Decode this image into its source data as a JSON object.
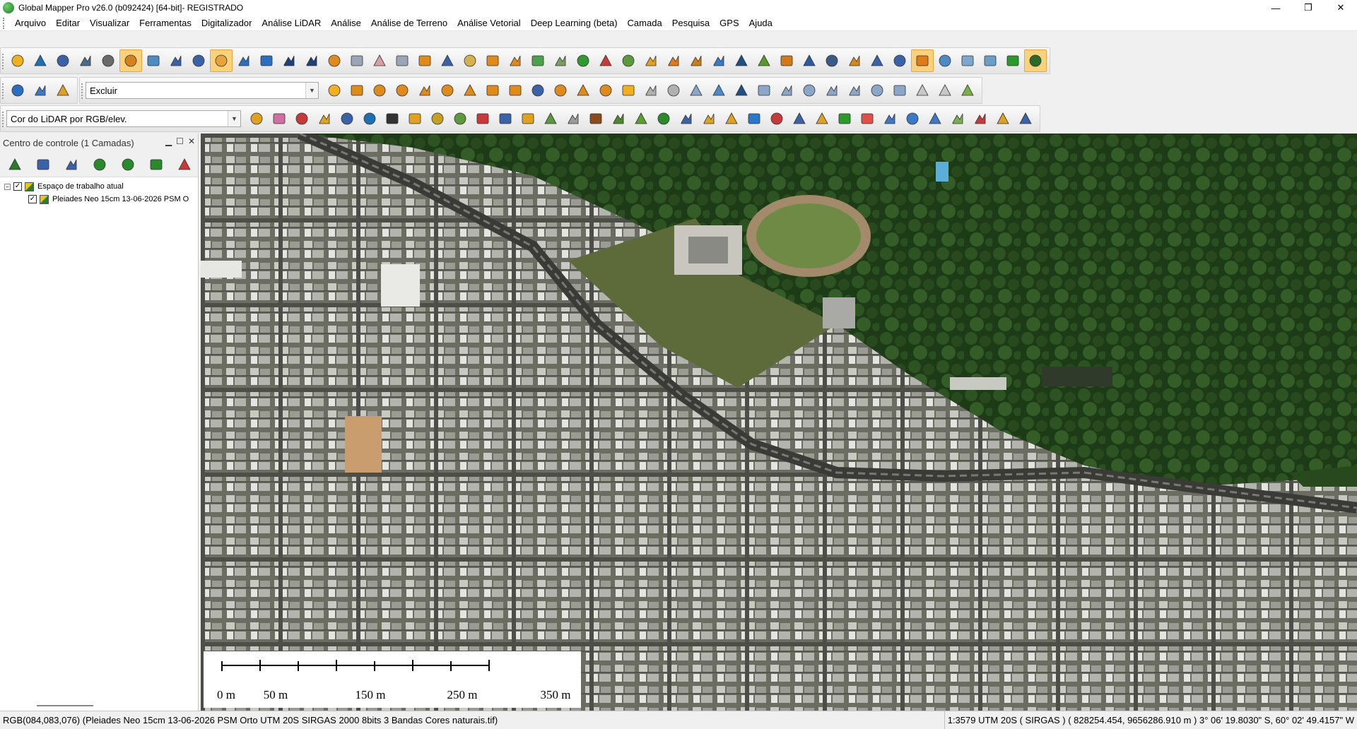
{
  "window": {
    "title": "Global Mapper Pro v26.0 (b092424) [64-bit]- REGISTRADO",
    "minimize": "—",
    "maximize": "❐",
    "close": "✕"
  },
  "menu": [
    "Arquivo",
    "Editar",
    "Visualizar",
    "Ferramentas",
    "Digitalizador",
    "Análise LiDAR",
    "Análise",
    "Análise de Terreno",
    "Análise Vetorial",
    "Deep Learning (beta)",
    "Camada",
    "Pesquisa",
    "GPS",
    "Ajuda"
  ],
  "toolbar": {
    "row1": [
      {
        "icon": "open-folder-icon",
        "color": "#f2b01e"
      },
      {
        "icon": "globe-data-icon",
        "color": "#1f6fb5"
      },
      {
        "icon": "save-icon",
        "color": "#3a62a8"
      },
      {
        "icon": "print-icon",
        "color": "#4a6a8a"
      },
      {
        "icon": "wrench-icon",
        "color": "#6a6a6a"
      },
      {
        "icon": "control-center-icon",
        "color": "#d4821b",
        "active": true
      },
      {
        "icon": "overview-map-icon",
        "color": "#4c8bc4"
      },
      {
        "icon": "find-icon",
        "color": "#3a62a8"
      },
      {
        "icon": "zoom-box-icon",
        "color": "#3a62a8"
      },
      {
        "icon": "pan-hand-icon",
        "color": "#e8a33a",
        "active": true
      },
      {
        "icon": "zoom-in-icon",
        "color": "#2a6fc1"
      },
      {
        "icon": "zoom-out-icon",
        "color": "#2a6fc1"
      },
      {
        "icon": "back-arrow-icon",
        "color": "#1f3f7a"
      },
      {
        "icon": "home-icon",
        "color": "#1f3f7a"
      },
      {
        "icon": "pencil-icon",
        "color": "#e08a1a"
      },
      {
        "icon": "select-box-icon",
        "color": "#9aa6b8"
      },
      {
        "icon": "delete-x-icon",
        "color": "#d8a0a0"
      },
      {
        "icon": "area-select-icon",
        "color": "#9aa6b8"
      },
      {
        "icon": "measure-icon",
        "color": "#e08a1a"
      },
      {
        "icon": "info-icon",
        "color": "#3a62a8"
      },
      {
        "icon": "path-profile-icon",
        "color": "#d6b04a"
      },
      {
        "icon": "lidar-profile-icon",
        "color": "#e08a1a"
      },
      {
        "icon": "terrain-icon",
        "color": "#e08a1a"
      },
      {
        "icon": "contour-icon",
        "color": "#4aa24a"
      },
      {
        "icon": "elevation-shade-icon",
        "color": "#7aa060"
      },
      {
        "icon": "terrain-green-icon",
        "color": "#2f9a2f"
      },
      {
        "icon": "cut-fill-icon",
        "color": "#c93a3a"
      },
      {
        "icon": "watershed-icon",
        "color": "#5a9a3a"
      },
      {
        "icon": "tower-icon",
        "color": "#e0a020"
      },
      {
        "icon": "layers-orange-icon",
        "color": "#e07a1a"
      },
      {
        "icon": "profile-lines-icon",
        "color": "#c8801a"
      },
      {
        "icon": "raster-calc-icon",
        "color": "#3a78c8"
      },
      {
        "icon": "crossing-icon",
        "color": "#1f4f8a"
      },
      {
        "icon": "pen-line-icon",
        "color": "#5a9a2a"
      },
      {
        "icon": "edit-pen-icon",
        "color": "#d07a1a"
      },
      {
        "icon": "house-pin-icon",
        "color": "#2a5aa0"
      },
      {
        "icon": "panels-icon",
        "color": "#3a5a8a"
      },
      {
        "icon": "script-icon",
        "color": "#d08a1a"
      },
      {
        "icon": "split-view-icon",
        "color": "#3a62a8"
      },
      {
        "icon": "3d-view-icon",
        "color": "#3a62a8"
      },
      {
        "icon": "digitize-active-icon",
        "color": "#e07a1a",
        "active": true
      },
      {
        "icon": "mountains-blue-icon",
        "color": "#4a8ac8"
      },
      {
        "icon": "mountain-flag-icon",
        "color": "#7aa8d0"
      },
      {
        "icon": "vegetation-icon",
        "color": "#6aa0c8"
      },
      {
        "icon": "peaks-green-icon",
        "color": "#2a9a2a"
      },
      {
        "icon": "mountains-yellow-icon",
        "color": "#2a6a2a",
        "active": true
      }
    ],
    "row2_left": [
      {
        "icon": "projection-globe-icon",
        "color": "#2a6fc1"
      },
      {
        "icon": "settings-gear-icon",
        "color": "#3a78c8"
      },
      {
        "icon": "night-mode-icon",
        "color": "#e0a020"
      }
    ],
    "style_combo": {
      "value": "Excluir"
    },
    "row2_right": [
      {
        "icon": "favorite-star-icon",
        "color": "#f2b01e"
      },
      {
        "icon": "digitize-line-icon",
        "color": "#e08a1a"
      },
      {
        "icon": "digitize-path-icon",
        "color": "#e08a1a"
      },
      {
        "icon": "digitize-curve-icon",
        "color": "#e08a1a"
      },
      {
        "icon": "edit-vertex-icon",
        "color": "#e08a1a"
      },
      {
        "icon": "smooth-line-icon",
        "color": "#e08a1a"
      },
      {
        "icon": "join-lines-icon",
        "color": "#e08a1a"
      },
      {
        "icon": "measure-angle-icon",
        "color": "#e08a1a"
      },
      {
        "icon": "range-ring-icon",
        "color": "#e08a1a"
      },
      {
        "icon": "grid-create-icon",
        "color": "#3a62a8"
      },
      {
        "icon": "buffer-line-icon",
        "color": "#e08a1a"
      },
      {
        "icon": "offset-line-icon",
        "color": "#e08a1a"
      },
      {
        "icon": "line-tool-icon",
        "color": "#e08a1a"
      },
      {
        "icon": "shape-merge-icon",
        "color": "#f2b01e"
      },
      {
        "icon": "line-disabled-icon",
        "color": "#b0b0b0"
      },
      {
        "icon": "edit-disabled-icon",
        "color": "#b0b0b0"
      },
      {
        "icon": "move-feature-icon",
        "color": "#8aa6c8"
      },
      {
        "icon": "rotate-feature-icon",
        "color": "#4a8ac8"
      },
      {
        "icon": "vertex-path-icon",
        "color": "#1f4f8a"
      },
      {
        "icon": "move-cross-icon",
        "color": "#8aa6c8"
      },
      {
        "icon": "scale-feature-icon",
        "color": "#8aa6c8"
      },
      {
        "icon": "snap-line-icon",
        "color": "#8aa6c8"
      },
      {
        "icon": "split-line-icon",
        "color": "#8aa6c8"
      },
      {
        "icon": "node-edit-icon",
        "color": "#8aa6c8"
      },
      {
        "icon": "vertex-select-icon",
        "color": "#8aa6c8"
      },
      {
        "icon": "vertex-delete-icon",
        "color": "#8aa6c8"
      },
      {
        "icon": "vertex-insert-icon",
        "color": "#c8c8c8"
      },
      {
        "icon": "crop-icon",
        "color": "#c8c8c8"
      },
      {
        "icon": "ruler-green-icon",
        "color": "#7ab04a"
      }
    ],
    "row3_left": {
      "combo_value": "Cor do LiDAR por RGB/elev."
    },
    "row3_tools": [
      {
        "icon": "lidar-filter-icon",
        "color": "#e0a020"
      },
      {
        "icon": "lidar-points-icon",
        "color": "#d070a0"
      },
      {
        "icon": "lidar-search-icon",
        "color": "#c83a3a"
      },
      {
        "icon": "lidar-select-icon",
        "color": "#e0a020"
      },
      {
        "icon": "lidar-grid-icon",
        "color": "#3a62a8"
      },
      {
        "icon": "lidar-edit-icon",
        "color": "#1f6fb5"
      },
      {
        "icon": "triangle-icon",
        "color": "#333333"
      },
      {
        "icon": "classify-icon",
        "color": "#e0a020"
      },
      {
        "icon": "segment-icon",
        "color": "#c8a020"
      },
      {
        "icon": "terrain-points-icon",
        "color": "#5a9a3a"
      },
      {
        "icon": "surface-layers-icon",
        "color": "#c83a3a"
      },
      {
        "icon": "noise-icon",
        "color": "#3a62a8"
      },
      {
        "icon": "building-extract-icon",
        "color": "#e0a020"
      },
      {
        "icon": "feature-extract-icon",
        "color": "#5a9a3a"
      },
      {
        "icon": "lidar-paint-icon",
        "color": "#9a9a9a"
      },
      {
        "icon": "ground-class-icon",
        "color": "#8a4a1a"
      },
      {
        "icon": "low-veg-icon",
        "color": "#4a8a2a"
      },
      {
        "icon": "medium-veg-icon",
        "color": "#5aa02a"
      },
      {
        "icon": "high-veg-icon",
        "color": "#2a8a2a"
      },
      {
        "icon": "building-class-icon",
        "color": "#3a62a8"
      },
      {
        "icon": "powerline-icon",
        "color": "#e0a020"
      },
      {
        "icon": "tower-class-icon",
        "color": "#e0a020"
      },
      {
        "icon": "water-class-icon",
        "color": "#2a78c8"
      },
      {
        "icon": "rail-class-icon",
        "color": "#c83a3a"
      },
      {
        "icon": "key-class-icon",
        "color": "#3a62a8"
      },
      {
        "icon": "bridge-class-icon",
        "color": "#e0a020"
      },
      {
        "icon": "play-icon",
        "color": "#2a9a2a"
      },
      {
        "icon": "stop-icon",
        "color": "#e0504a"
      },
      {
        "icon": "fly-through-icon",
        "color": "#3a78c8"
      },
      {
        "icon": "forward-path-icon",
        "color": "#3a78c8"
      },
      {
        "icon": "add-point-icon",
        "color": "#3a78c8"
      },
      {
        "icon": "remove-point-icon",
        "color": "#7ab04a"
      },
      {
        "icon": "map-layout-icon",
        "color": "#c83a3a"
      },
      {
        "icon": "package-icon",
        "color": "#e0a020"
      },
      {
        "icon": "dashboard-icon",
        "color": "#3a62a8"
      }
    ]
  },
  "control_center": {
    "title": "Centro de controle (1 Camadas)",
    "tools": [
      "open-layer-icon",
      "layer-options-icon",
      "attribute-table-icon",
      "add-layer-icon",
      "zoom-layer-icon",
      "layer-visibility-icon",
      "remove-layer-icon"
    ],
    "workspace_label": "Espaço de trabalho atual",
    "layer_name": "Pleiades Neo 15cm 13-06-2026 PSM O"
  },
  "map": {
    "scale_labels": [
      "0 m",
      "50 m",
      "150 m",
      "250 m",
      "350 m"
    ]
  },
  "status": {
    "left": "RGB(084,083,076) (Pleiades Neo 15cm 13-06-2026 PSM Orto UTM 20S SIRGAS 2000 8bits 3 Bandas Cores naturais.tif)",
    "right": "1:3579  UTM 20S ( SIRGAS ) ( 828254.454, 9656286.910 m ) 3° 06' 19.8030\" S, 60° 02' 49.4157\" W"
  }
}
